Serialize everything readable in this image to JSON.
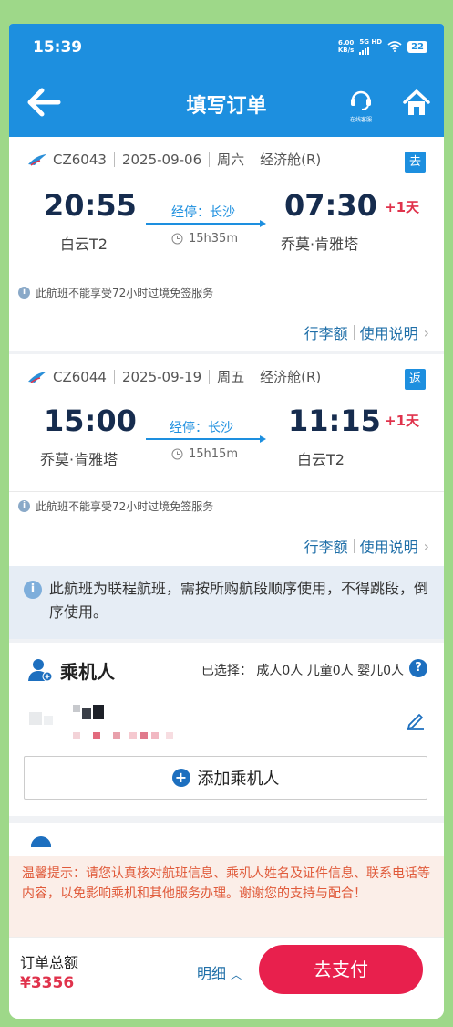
{
  "status_bar": {
    "time": "15:39",
    "net_speed_value": "6.00",
    "net_speed_unit": "KB/s",
    "net_type": "5G HD",
    "battery": "22"
  },
  "header": {
    "title": "填写订单",
    "service_label": "在线客服",
    "colors": {
      "header_bg": "#1d8fdf"
    }
  },
  "flights": [
    {
      "flight_no": "CZ6043",
      "date": "2025-09-06",
      "weekday": "周六",
      "cabin": "经济舱(R)",
      "direction": "去",
      "dep_time": "20:55",
      "dep_airport": "白云T2",
      "via": "经停：长沙",
      "duration": "15h35m",
      "arr_time": "07:30",
      "arr_airport": "乔莫·肯雅塔",
      "plus_day": "+1天",
      "visa_notice": "此航班不能享受72小时过境免签服务",
      "baggage_link": "行李额",
      "usage_link": "使用说明"
    },
    {
      "flight_no": "CZ6044",
      "date": "2025-09-19",
      "weekday": "周五",
      "cabin": "经济舱(R)",
      "direction": "返",
      "dep_time": "15:00",
      "dep_airport": "乔莫·肯雅塔",
      "via": "经停：长沙",
      "duration": "15h15m",
      "arr_time": "11:15",
      "arr_airport": "白云T2",
      "plus_day": "+1天",
      "visa_notice": "此航班不能享受72小时过境免签服务",
      "baggage_link": "行李额",
      "usage_link": "使用说明"
    }
  ],
  "combo_notice": "此航班为联程航班，需按所购航段顺序使用，不得跳段，倒序使用。",
  "passengers": {
    "title": "乘机人",
    "selected_summary": "已选择：  成人0人  儿童0人  婴儿0人",
    "add_label": "添加乘机人"
  },
  "warm_tip": "温馨提示：请您认真核对航班信息、乘机人姓名及证件信息、联系电话等内容，以免影响乘机和其他服务办理。谢谢您的支持与配合！",
  "footer": {
    "total_label": "订单总额",
    "total_amount": "¥3356",
    "detail_label": "明细",
    "pay_label": "去支付"
  }
}
